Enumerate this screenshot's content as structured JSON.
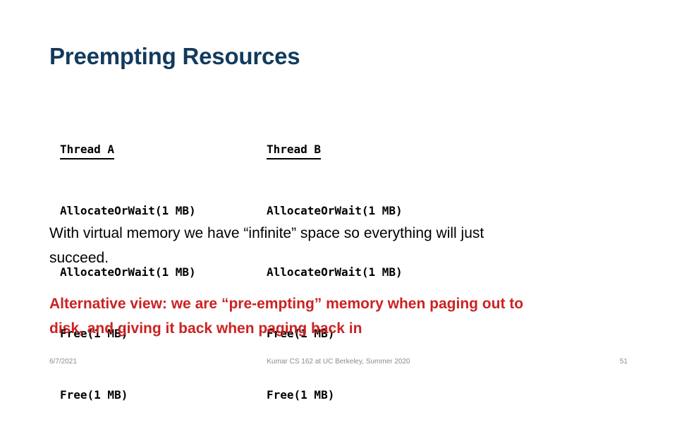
{
  "slide": {
    "title": "Preempting Resources",
    "title_color": "#123a5e",
    "background_color": "#ffffff"
  },
  "code_block": {
    "columns": [
      {
        "header": "Thread A",
        "lines": [
          "AllocateOrWait(1 MB)",
          "AllocateOrWait(1 MB)",
          "Free(1 MB)",
          "Free(1 MB)"
        ]
      },
      {
        "header": "Thread B",
        "lines": [
          "AllocateOrWait(1 MB)",
          "AllocateOrWait(1 MB)",
          "Free(1 MB)",
          "Free(1 MB)"
        ]
      }
    ]
  },
  "body": {
    "paragraph_1": "With virtual memory we have “infinite” space so everything will just succeed.",
    "paragraph_2": "Alternative view: we are “pre-empting” memory when paging out to disk, and giving it back when paging back in",
    "paragraph_2_color": "#cc2222"
  },
  "footer": {
    "date": "6/7/2021",
    "attribution": "Kumar CS 162 at UC Berkeley, Summer 2020",
    "page_number": "51",
    "color": "#8c8c8c"
  }
}
